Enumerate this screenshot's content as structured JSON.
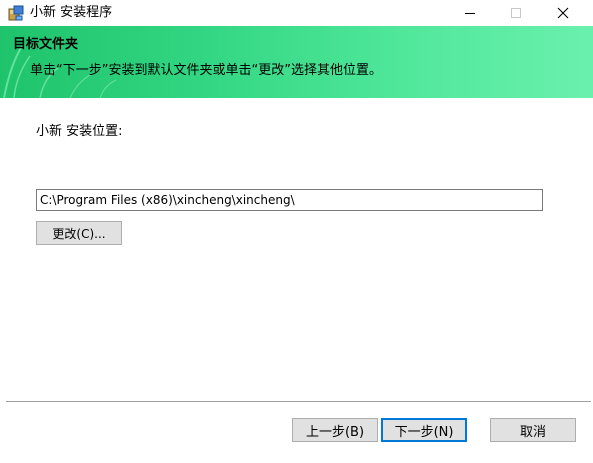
{
  "window": {
    "title": "小新 安装程序",
    "controls": {
      "minimize": "—",
      "close": "✕"
    }
  },
  "banner": {
    "title": "目标文件夹",
    "description": "单击“下一步”安装到默认文件夹或单击“更改”选择其他位置。"
  },
  "main": {
    "install_label": "小新 安装位置:",
    "path_value": "C:\\Program Files (x86)\\xincheng\\xincheng\\",
    "change_button": "更改(C)..."
  },
  "footer": {
    "back_button": "上一步(B)",
    "next_button": "下一步(N)",
    "cancel_button": "取消"
  }
}
